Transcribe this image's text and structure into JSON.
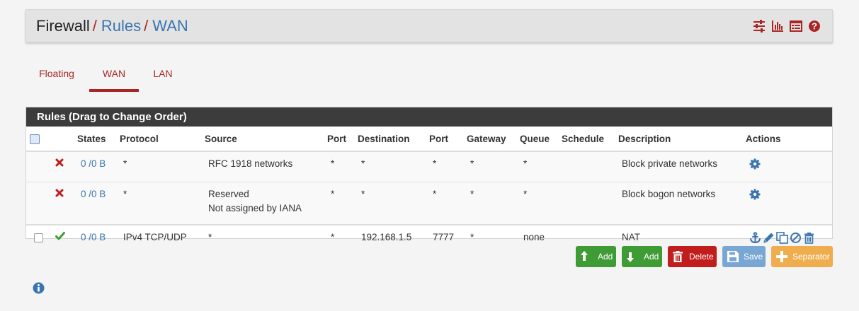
{
  "breadcrumb": {
    "root": "Firewall",
    "sep": "/",
    "rules": "Rules",
    "wan": "WAN"
  },
  "header_icons": [
    "settings-sliders-icon",
    "bar-chart-icon",
    "list-table-icon",
    "help-circle-icon"
  ],
  "tabs": [
    {
      "label": "Floating",
      "active": false
    },
    {
      "label": "WAN",
      "active": true
    },
    {
      "label": "LAN",
      "active": false
    }
  ],
  "panel": {
    "title": "Rules (Drag to Change Order)"
  },
  "table": {
    "headers": [
      "States",
      "Protocol",
      "Source",
      "Port",
      "Destination",
      "Port",
      "Gateway",
      "Queue",
      "Schedule",
      "Description",
      "Actions"
    ],
    "rows": [
      {
        "status": "block",
        "states": "0 /0 B",
        "protocol": "*",
        "source": "RFC 1918 networks",
        "source_sub": "",
        "port": "*",
        "destination": "*",
        "dport": "*",
        "gateway": "*",
        "queue": "*",
        "schedule": "",
        "description": "Block private networks"
      },
      {
        "status": "block",
        "states": "0 /0 B",
        "protocol": "*",
        "source": "Reserved",
        "source_sub": "Not assigned by IANA",
        "port": "*",
        "destination": "*",
        "dport": "*",
        "gateway": "*",
        "queue": "*",
        "schedule": "",
        "description": "Block bogon networks"
      },
      {
        "status": "pass",
        "states": "0 /0 B",
        "protocol": "IPv4 TCP/UDP",
        "source": "*",
        "source_sub": "",
        "port": "*",
        "destination": "192.168.1.5",
        "dport": "7777",
        "gateway": "*",
        "queue": "none",
        "schedule": "",
        "description": "NAT"
      }
    ]
  },
  "buttons": {
    "add_top": "Add",
    "add_bottom": "Add",
    "delete": "Delete",
    "save": "Save",
    "separator": "Separator"
  },
  "colors": {
    "accent": "#a82626",
    "link": "#3a75b0",
    "success": "#3f9c35",
    "danger": "#c21d1d",
    "save": "#79a7d3",
    "warning": "#f0ad4e",
    "panel_heading": "#3c3c3c"
  }
}
